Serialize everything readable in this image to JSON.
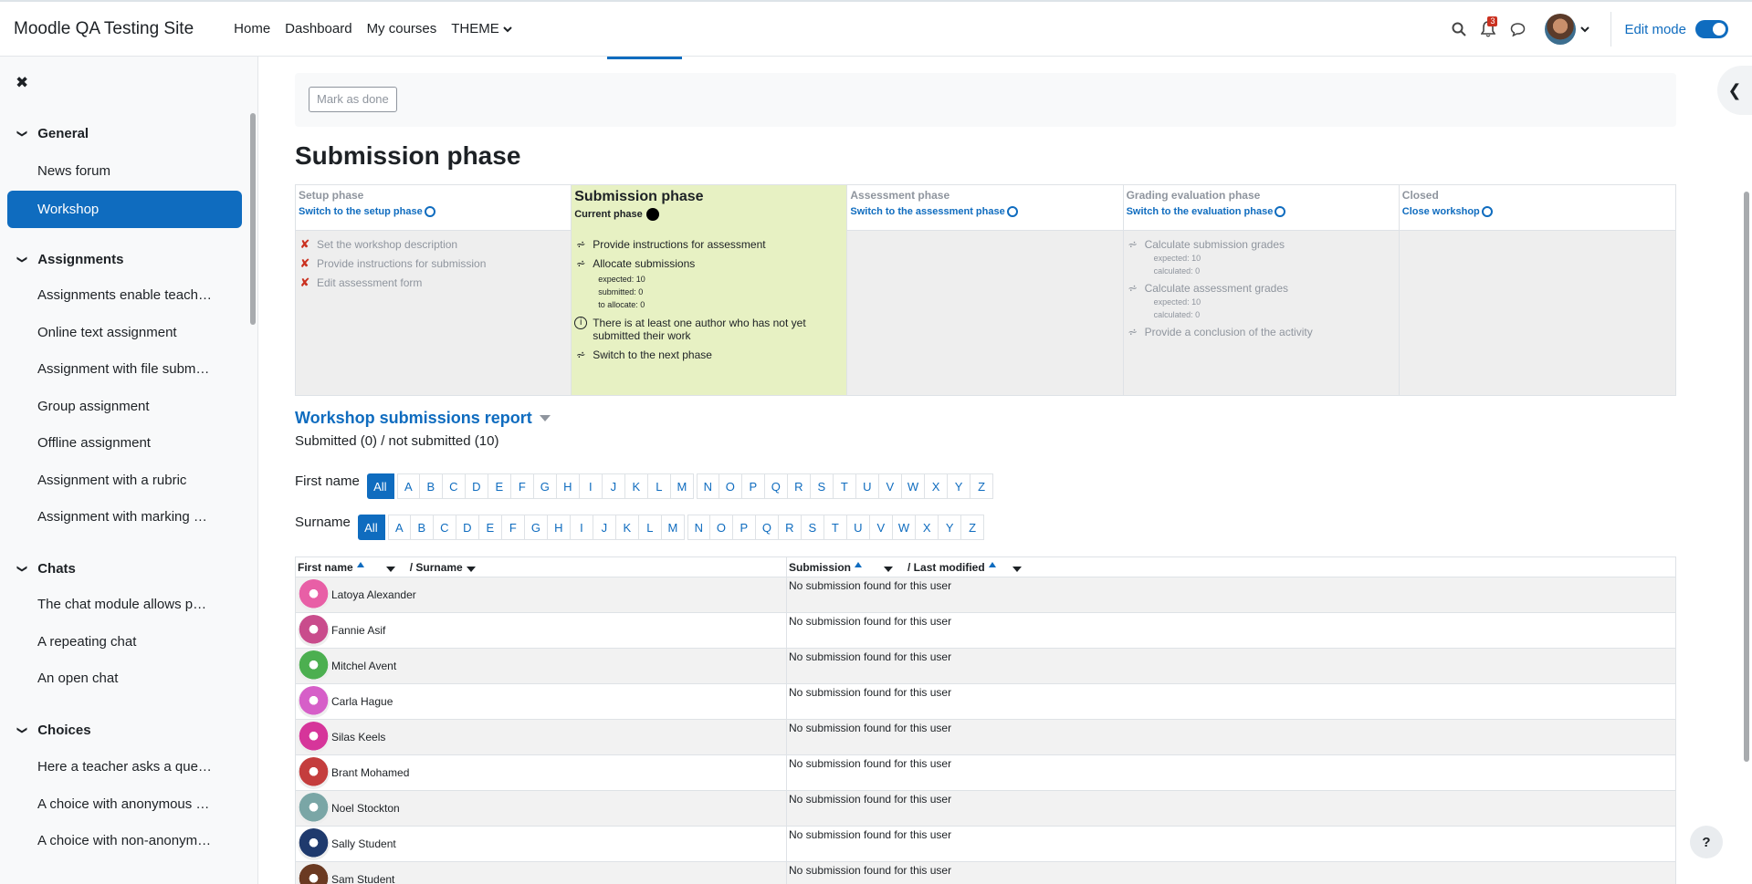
{
  "navbar": {
    "site_name": "Moodle QA Testing Site",
    "links": [
      "Home",
      "Dashboard",
      "My courses",
      "THEME"
    ],
    "notification_count": "3",
    "edit_mode_label": "Edit mode"
  },
  "sidebar": {
    "sections": [
      {
        "title": "General",
        "items": [
          "News forum",
          "Workshop"
        ]
      },
      {
        "title": "Assignments",
        "items": [
          "Assignments enable teach…",
          "Online text assignment",
          "Assignment with file subm…",
          "Group assignment",
          "Offline assignment",
          "Assignment with a rubric",
          "Assignment with marking …"
        ]
      },
      {
        "title": "Chats",
        "items": [
          "The chat module allows p…",
          "A repeating chat",
          "An open chat"
        ]
      },
      {
        "title": "Choices",
        "items": [
          "Here a teacher asks a que…",
          "A choice with anonymous …",
          "A choice with non-anonym…"
        ]
      }
    ],
    "active_item": "Workshop"
  },
  "main": {
    "mark_done_label": "Mark as done",
    "page_title": "Submission phase",
    "phases": [
      {
        "title": "Setup phase",
        "switch": "Switch to the setup phase",
        "tasks": [
          "Set the workshop description",
          "Provide instructions for submission",
          "Edit assessment form"
        ]
      },
      {
        "title": "Submission phase",
        "current": "Current phase",
        "tasks": [
          "Provide instructions for assessment",
          "Allocate submissions",
          "There is at least one author who has not yet submitted their work",
          "Switch to the next phase"
        ],
        "allocate_info": [
          "expected: 10",
          "submitted: 0",
          "to allocate: 0"
        ]
      },
      {
        "title": "Assessment phase",
        "switch": "Switch to the assessment phase"
      },
      {
        "title": "Grading evaluation phase",
        "switch": "Switch to the evaluation phase",
        "tasks": [
          "Calculate submission grades",
          "Calculate assessment grades",
          "Provide a conclusion of the activity"
        ],
        "sub_grades_info": [
          "expected: 10",
          "calculated: 0"
        ],
        "assess_grades_info": [
          "expected: 10",
          "calculated: 0"
        ]
      },
      {
        "title": "Closed",
        "switch": "Close workshop"
      }
    ],
    "report_title": "Workshop submissions report",
    "counts": "Submitted (0) / not submitted (10)",
    "firstname_label": "First name",
    "surname_label": "Surname",
    "all_label": "All",
    "letters": [
      "A",
      "B",
      "C",
      "D",
      "E",
      "F",
      "G",
      "H",
      "I",
      "J",
      "K",
      "L",
      "M",
      "N",
      "O",
      "P",
      "Q",
      "R",
      "S",
      "T",
      "U",
      "V",
      "W",
      "X",
      "Y",
      "Z"
    ],
    "table": {
      "col_first": "First name",
      "col_surname": "/ Surname",
      "col_submission": "Submission",
      "col_modified": "/ Last modified",
      "no_sub": "No submission found for this user",
      "users": [
        "Latoya Alexander",
        "Fannie Asif",
        "Mitchel Avent",
        "Carla Hague",
        "Silas Keels",
        "Brant Mohamed",
        "Noel Stockton",
        "Sally Student",
        "Sam Student"
      ]
    }
  },
  "help_label": "?",
  "colors": {
    "primary": "#0f6cbf",
    "current_phase_bg": "#e7f1c3",
    "error": "#ca3120"
  }
}
